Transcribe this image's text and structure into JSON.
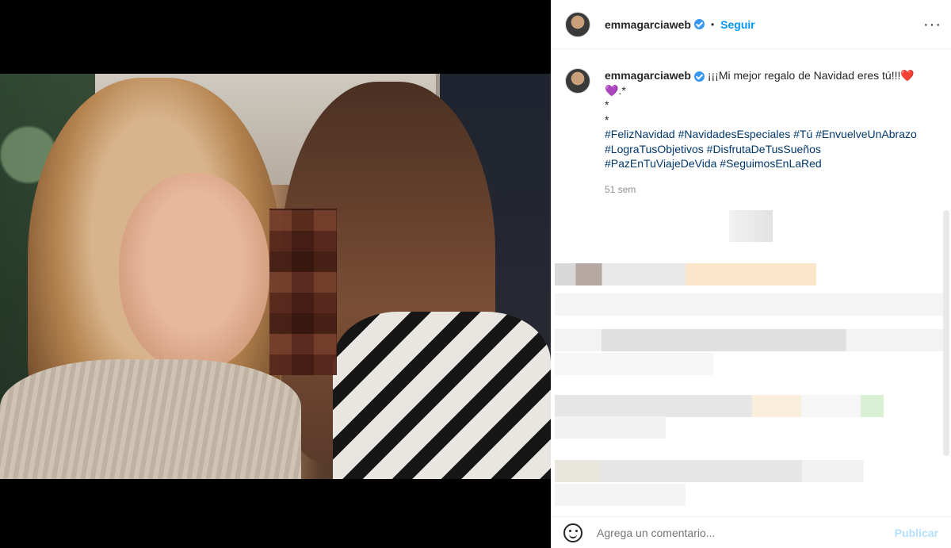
{
  "post": {
    "username": "emmagarciaweb",
    "follow_label": "Seguir",
    "more_label": "···",
    "dot_separator": "•",
    "caption_text": "¡¡¡Mi mejor regalo de Navidad eres tú!!!❤️",
    "caption_line2": "💜.*",
    "caption_line3": "*",
    "caption_line4": "*",
    "hashtags_line1": "#FelizNavidad #NavidadesEspeciales #Tú #EnvuelveUnAbrazo",
    "hashtags_line2": "#LograTusObjetivos #DisfrutaDeTusSueños",
    "hashtags_line3": "#PazEnTuViajeDeVida #SeguimosEnLaRed",
    "time_ago": "51 sem"
  },
  "comment_box": {
    "placeholder": "Agrega un comentario...",
    "post_label": "Publicar"
  },
  "colors": {
    "accent": "#0095f6",
    "hashtag": "#00376b",
    "muted": "#8e8e8e",
    "verified": "#3897f0"
  },
  "icons": [
    "verified-badge-icon",
    "more-options-icon",
    "emoji-icon"
  ]
}
